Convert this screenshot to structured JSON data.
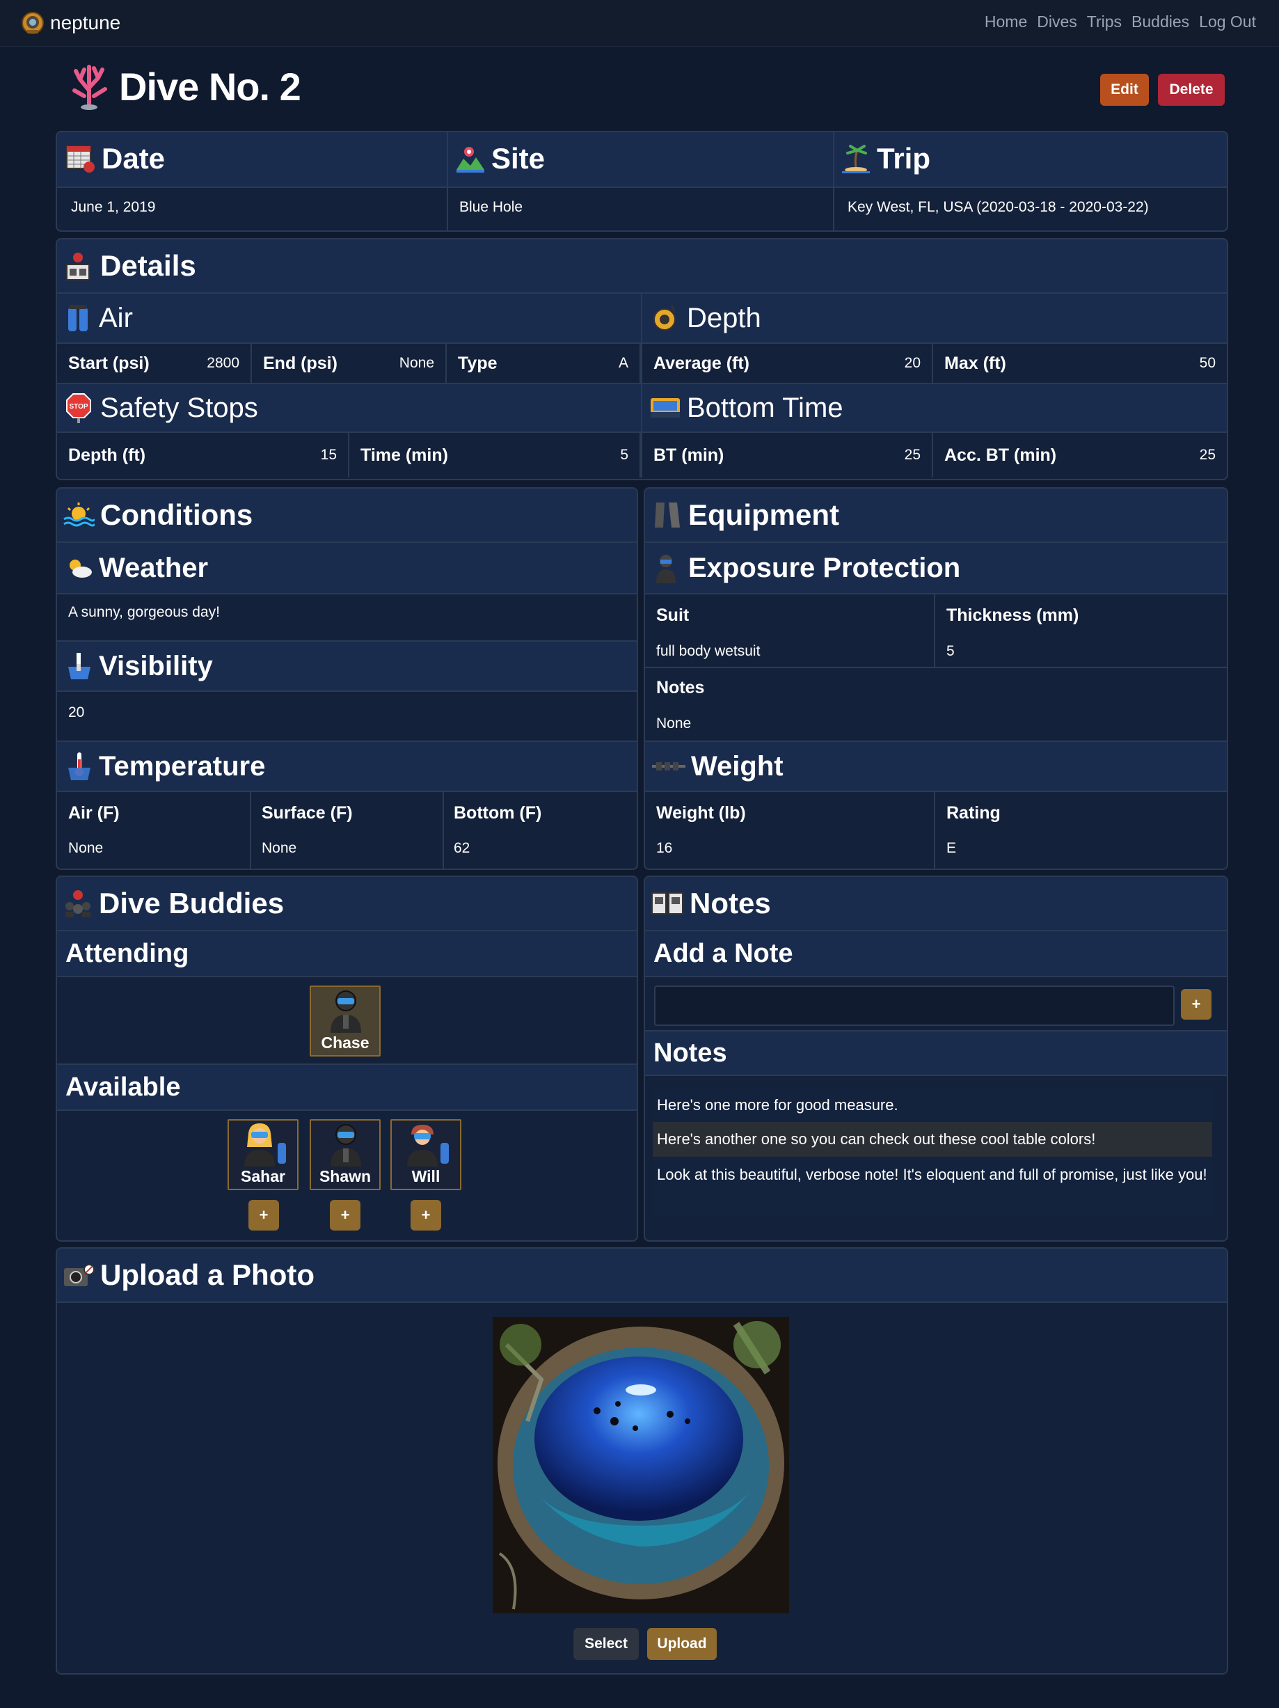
{
  "nav": {
    "brand": "neptune",
    "links": [
      "Home",
      "Dives",
      "Trips",
      "Buddies",
      "Log Out"
    ]
  },
  "page": {
    "title": "Dive No. 2",
    "edit_label": "Edit",
    "delete_label": "Delete"
  },
  "summary": {
    "date_label": "Date",
    "date_value": "June 1, 2019",
    "site_label": "Site",
    "site_value": "Blue Hole",
    "trip_label": "Trip",
    "trip_value": "Key West, FL, USA (2020-03-18 - 2020-03-22)"
  },
  "details": {
    "title": "Details",
    "air": {
      "title": "Air",
      "start_label": "Start (psi)",
      "start_value": "2800",
      "end_label": "End (psi)",
      "end_value": "None",
      "type_label": "Type",
      "type_value": "A"
    },
    "depth": {
      "title": "Depth",
      "avg_label": "Average (ft)",
      "avg_value": "20",
      "max_label": "Max (ft)",
      "max_value": "50"
    },
    "safety": {
      "title": "Safety Stops",
      "depth_label": "Depth (ft)",
      "depth_value": "15",
      "time_label": "Time (min)",
      "time_value": "5"
    },
    "bottom": {
      "title": "Bottom Time",
      "bt_label": "BT (min)",
      "bt_value": "25",
      "acc_label": "Acc. BT (min)",
      "acc_value": "25"
    }
  },
  "conditions": {
    "title": "Conditions",
    "weather_title": "Weather",
    "weather_value": "A sunny, gorgeous day!",
    "visibility_title": "Visibility",
    "visibility_value": "20",
    "temperature_title": "Temperature",
    "air_label": "Air (F)",
    "air_value": "None",
    "surface_label": "Surface (F)",
    "surface_value": "None",
    "bottom_label": "Bottom (F)",
    "bottom_value": "62"
  },
  "equipment": {
    "title": "Equipment",
    "exposure_title": "Exposure Protection",
    "suit_label": "Suit",
    "suit_value": "full body wetsuit",
    "thickness_label": "Thickness (mm)",
    "thickness_value": "5",
    "notes_label": "Notes",
    "notes_value": "None",
    "weight_title": "Weight",
    "weight_label": "Weight (lb)",
    "weight_value": "16",
    "rating_label": "Rating",
    "rating_value": "E"
  },
  "buddies": {
    "title": "Dive Buddies",
    "attending_title": "Attending",
    "attending": [
      "Chase"
    ],
    "available_title": "Available",
    "available": [
      "Sahar",
      "Shawn",
      "Will"
    ],
    "add_label": "+"
  },
  "notes": {
    "title": "Notes",
    "add_title": "Add a Note",
    "add_button": "+",
    "list_title": "Notes",
    "items": [
      "Here's one more for good measure.",
      "Here's another one so you can check out these cool table colors!",
      "Look at this beautiful, verbose note! It's eloquent and full of promise, just like you!"
    ]
  },
  "photo": {
    "title": "Upload a Photo",
    "select_label": "Select",
    "upload_label": "Upload"
  },
  "colors": {
    "background": "#0f1a2e",
    "card": "#14213a",
    "header": "#1a2c4d",
    "edit": "#b8501e",
    "delete": "#b02636",
    "gold": "#8e6a2e"
  }
}
